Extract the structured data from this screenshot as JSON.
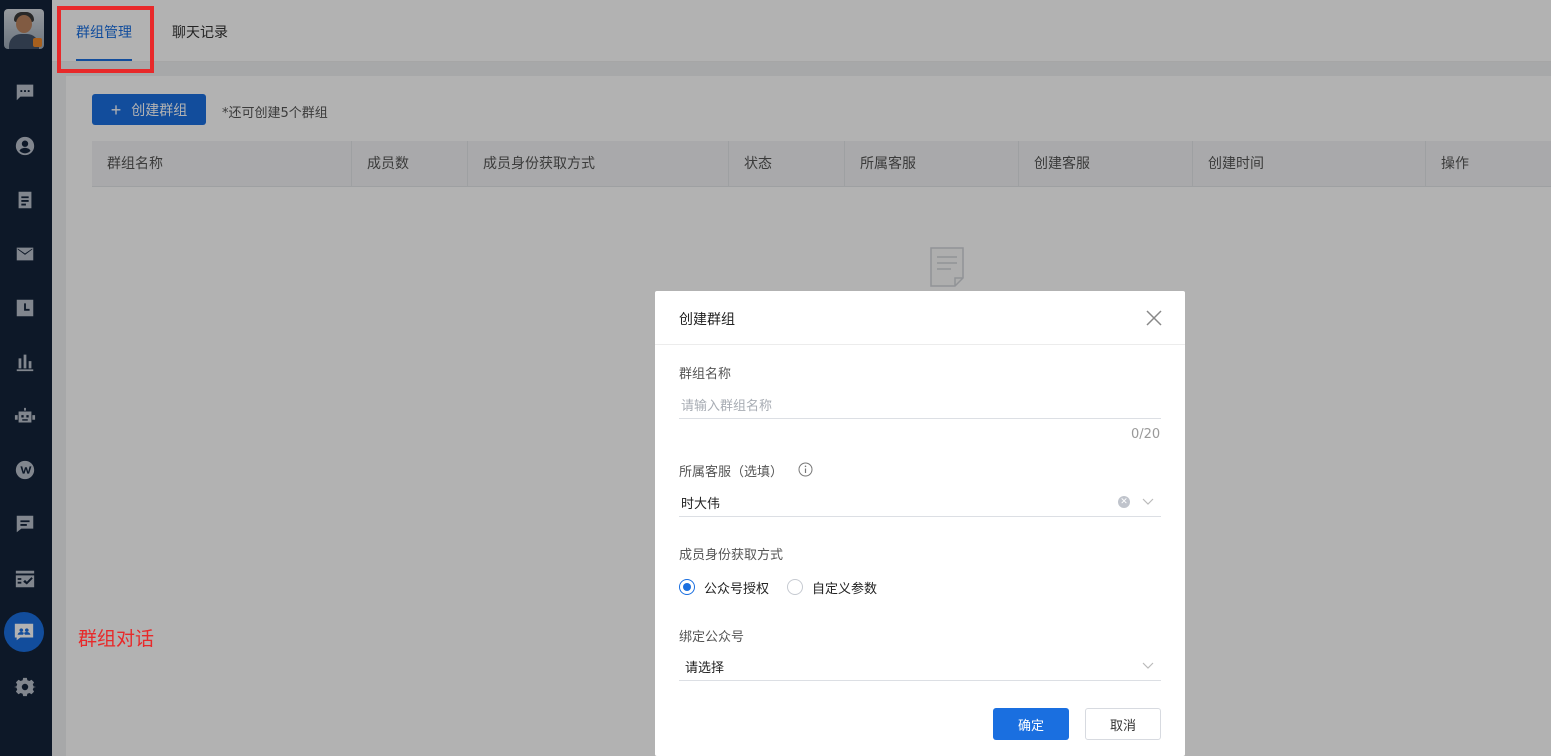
{
  "sidebar": {
    "icons": [
      "chat-icon",
      "user-icon",
      "form-icon",
      "mail-icon",
      "clock-icon",
      "stats-icon",
      "robot-icon",
      "weibo-icon",
      "message-icon",
      "task-icon",
      "group-chat-icon",
      "gear-icon"
    ],
    "active": "group-chat-icon"
  },
  "tabs": [
    {
      "label": "群组管理",
      "active": true
    },
    {
      "label": "聊天记录",
      "active": false
    }
  ],
  "toolbar": {
    "create_label": "创建群组",
    "remaining_text": "*还可创建5个群组"
  },
  "table": {
    "columns": [
      "群组名称",
      "成员数",
      "成员身份获取方式",
      "状态",
      "所属客服",
      "创建客服",
      "创建时间",
      "操作"
    ]
  },
  "annotation": "群组对话",
  "modal": {
    "title": "创建群组",
    "group_name_label": "群组名称",
    "group_name_placeholder": "请输入群组名称",
    "group_name_counter": "0/20",
    "agent_label": "所属客服（选填）",
    "agent_value": "时大伟",
    "identity_label": "成员身份获取方式",
    "identity_options": [
      "公众号授权",
      "自定义参数"
    ],
    "identity_selected": "公众号授权",
    "bind_label": "绑定公众号",
    "bind_value": "请选择",
    "ok_label": "确定",
    "cancel_label": "取消"
  },
  "colors": {
    "accent": "#1a6fe0",
    "sidebar_bg": "#14233a",
    "annotation": "#e8292a"
  }
}
